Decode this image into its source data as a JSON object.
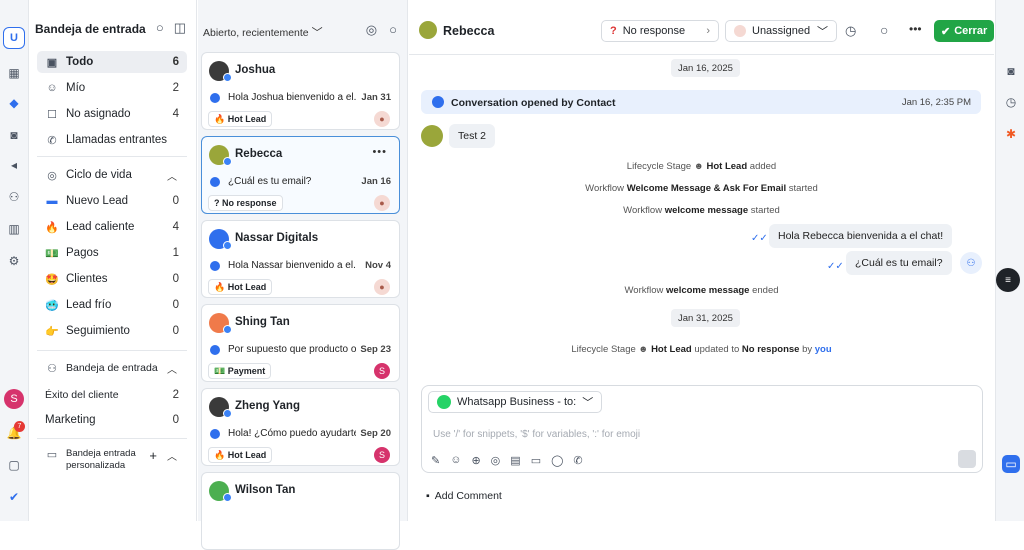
{
  "rail": {
    "logo": "U",
    "avatar": "S",
    "notif": "7",
    "icons": [
      "inbox-icon",
      "conversations-icon",
      "contacts-icon",
      "broadcast-icon",
      "workflow-icon",
      "reports-icon",
      "settings-icon"
    ]
  },
  "inbox": {
    "title": "Bandeja de entrada",
    "items": [
      {
        "label": "Todo",
        "count": "6"
      },
      {
        "label": "Mío",
        "count": "2"
      },
      {
        "label": "No asignado",
        "count": "4"
      },
      {
        "label": "Llamadas entrantes",
        "count": ""
      }
    ],
    "lifecycle_title": "Ciclo de vida",
    "lifecycle": [
      {
        "label": "Nuevo Lead",
        "count": "0"
      },
      {
        "label": "Lead caliente",
        "count": "4"
      },
      {
        "label": "Pagos",
        "count": "1"
      },
      {
        "label": "Clientes",
        "count": "0"
      },
      {
        "label": "Lead frío",
        "count": "0"
      },
      {
        "label": "Seguimiento",
        "count": "0"
      }
    ],
    "team_title": "Bandeja de entrada",
    "team": [
      {
        "label": "Éxito del cliente",
        "count": "2"
      },
      {
        "label": "Marketing",
        "count": "0"
      }
    ],
    "custom_title": "Bandeja entrada personalizada"
  },
  "list": {
    "filter": "Abierto, recientemente",
    "cards": [
      {
        "name": "Joshua",
        "msg": "Hola Joshua bienvenido a el...",
        "date": "Jan 31",
        "tag": "🔥 Hot Lead",
        "av": "#3a3a3a",
        "assignee": "person"
      },
      {
        "name": "Rebecca",
        "msg": "¿Cuál es tu email?",
        "date": "Jan 16",
        "tag": "? No response",
        "av": "#9aa63a",
        "assignee": "person"
      },
      {
        "name": "Nassar Digitals",
        "msg": "Hola Nassar bienvenido a el...",
        "date": "Nov 4",
        "tag": "🔥 Hot Lead",
        "av": "#2f6fed",
        "assignee": "person"
      },
      {
        "name": "Shing Tan",
        "msg": "Por supuesto que producto o...",
        "date": "Sep 23",
        "tag": "💵 Payment",
        "av": "#f07a4a",
        "assignee": "S"
      },
      {
        "name": "Zheng Yang",
        "msg": "Hola! ¿Cómo puedo ayudarte?",
        "date": "Sep 20",
        "tag": "🔥 Hot Lead",
        "av": "#3a3a3a",
        "assignee": "S"
      },
      {
        "name": "Wilson Tan",
        "msg": "",
        "date": "",
        "tag": "",
        "av": "#4caf50",
        "assignee": ""
      }
    ]
  },
  "conv": {
    "name": "Rebecca",
    "status": "No response",
    "assignee": "Unassigned",
    "close": "Cerrar",
    "date1": "Jan 16, 2025",
    "opened": "Conversation opened by Contact",
    "opened_time": "Jan 16, 2:35 PM",
    "contact_msg": "Test 2",
    "sys1a": "Lifecycle Stage",
    "sys1b": "Hot Lead",
    "sys1c": "added",
    "sys2a": "Workflow",
    "sys2b": "Welcome Message & Ask For Email",
    "sys2c": "started",
    "sys3a": "Workflow",
    "sys3b": "welcome message",
    "sys3c": "started",
    "out1": "Hola Rebecca bienvenida a el chat!",
    "out2": "¿Cuál es tu email?",
    "sys4a": "Workflow",
    "sys4b": "welcome message",
    "sys4c": "ended",
    "date2": "Jan 31, 2025",
    "sys5a": "Lifecycle Stage",
    "sys5b": "Hot Lead",
    "sys5c": "updated to",
    "sys5d": "No response",
    "sys5e": "by",
    "sys5f": "you",
    "channel": "Whatsapp Business - to:",
    "placeholder": "Use '/' for snippets, '$' for variables, ':' for emoji",
    "add_comment": "Add Comment"
  }
}
